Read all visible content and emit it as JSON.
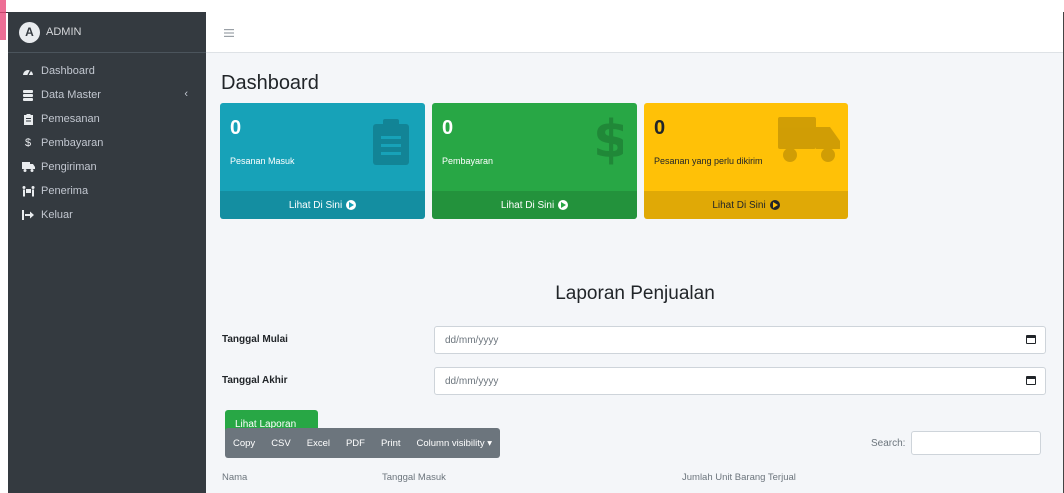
{
  "sidebar": {
    "brand": "ADMIN",
    "brand_logo": "A",
    "items": [
      {
        "label": "Dashboard",
        "icon": "tachometer-icon"
      },
      {
        "label": "Data Master",
        "icon": "database-icon"
      },
      {
        "label": "Pemesanan",
        "icon": "clipboard-icon"
      },
      {
        "label": "Pembayaran",
        "icon": "dollar-icon"
      },
      {
        "label": "Pengiriman",
        "icon": "truck-icon"
      },
      {
        "label": "Penerima",
        "icon": "people-carry-icon"
      },
      {
        "label": "Keluar",
        "icon": "sign-out-icon"
      }
    ]
  },
  "navbar": {
    "menu_icon": "bars-icon"
  },
  "page": {
    "title": "Dashboard"
  },
  "boxes": [
    {
      "count": "0",
      "label": "Pesanan Masuk",
      "footer": "Lihat Di Sini",
      "color": "#17a2b8",
      "icon": "clipboard-list-icon"
    },
    {
      "count": "0",
      "label": "Pembayaran",
      "footer": "Lihat Di Sini",
      "color": "#28a745",
      "icon": "dollar-sign-icon"
    },
    {
      "count": "0",
      "label": "Pesanan yang perlu dikirim",
      "footer": "Lihat Di Sini",
      "color": "#ffc107",
      "icon": "truck-icon"
    }
  ],
  "report": {
    "title": "Laporan Penjualan",
    "start_label": "Tanggal Mulai",
    "start_placeholder": "dd/mm/yyyy",
    "end_label": "Tanggal Akhir",
    "end_placeholder": "dd/mm/yyyy",
    "button": "Lihat Laporan"
  },
  "table": {
    "buttons": [
      "Copy",
      "CSV",
      "Excel",
      "PDF",
      "Print",
      "Column visibility ▾"
    ],
    "search_label": "Search:",
    "columns": [
      "Nama",
      "Tanggal Masuk",
      "Jumlah Unit Barang Terjual"
    ]
  }
}
